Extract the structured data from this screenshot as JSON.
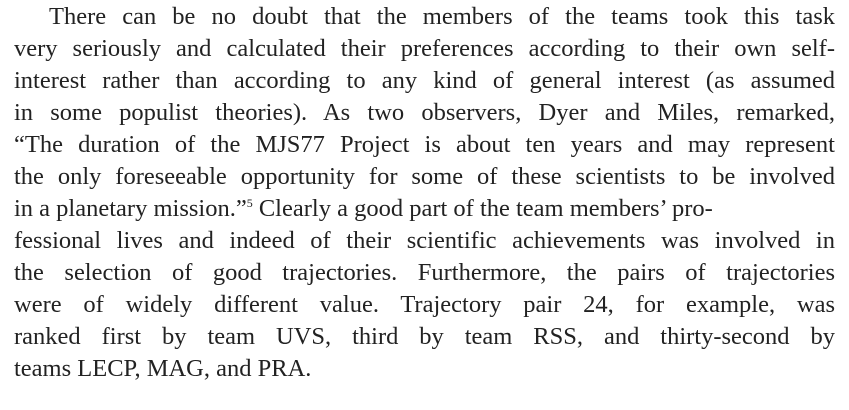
{
  "document": {
    "lines": [
      "There can be no doubt that the members of the teams took this task",
      "very seriously and calculated their preferences according to their own self-",
      "interest rather than according to any kind of general interest (as assumed",
      "in some populist theories). As two observers, Dyer and Miles, remarked,",
      "“The duration of the MJS77 Project is about ten years and may represent",
      "the only foreseeable opportunity for some of these scientists to be involved",
      "in a planetary mission.”",
      " Clearly a good part of the team members’ pro-",
      "fessional lives and indeed of their scientific achievements was involved in",
      "the selection of good trajectories. Furthermore, the pairs of trajectories",
      "were of widely different value. Trajectory pair 24, for example, was",
      "ranked first by team UVS, third by team RSS, and thirty-second by",
      "teams LECP, MAG, and PRA."
    ],
    "footnote_ref": "5"
  }
}
